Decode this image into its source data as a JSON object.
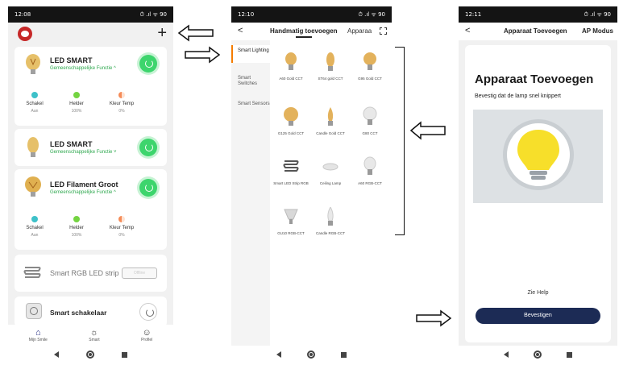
{
  "phone1": {
    "status_time": "12:08",
    "status_right": "⏱ .ıl ᯤ 90",
    "add_label": "+",
    "cards": [
      {
        "title": "LED SMART",
        "subtitle": "Gemeenschappelijke Functie ^",
        "controls": [
          {
            "label": "Schakel",
            "value": "Aan",
            "color": "#3ec1c9"
          },
          {
            "label": "Helder",
            "value": "100%",
            "color": "#74d441"
          },
          {
            "label": "Kleur Temp",
            "value": "0%",
            "color": "#f58b57"
          }
        ]
      },
      {
        "title": "LED SMART",
        "subtitle": "Gemeenschappelijke Functie ˅"
      },
      {
        "title": "LED Filament Groot",
        "subtitle": "Gemeenschappelijke Functie ^",
        "controls": [
          {
            "label": "Schakel",
            "value": "Aan",
            "color": "#3ec1c9"
          },
          {
            "label": "Helder",
            "value": "100%",
            "color": "#74d441"
          },
          {
            "label": "Kleur Temp",
            "value": "0%",
            "color": "#f58b57"
          }
        ]
      },
      {
        "title": "Smart RGB LED strip",
        "pill_label": "Offline"
      },
      {
        "title": "Smart schakelaar"
      }
    ],
    "tabs": [
      {
        "label": "Mijn Smile",
        "icon": "home-icon"
      },
      {
        "label": "Smart",
        "icon": "sun-icon"
      },
      {
        "label": "Profiel",
        "icon": "profile-icon"
      }
    ]
  },
  "phone2": {
    "status_time": "12:10",
    "status_right": "⏱ .ıl ᯤ 90",
    "back_label": "<",
    "tab_manual": "Handmatig toevoegen",
    "tab_ap": "Apparaa",
    "side_items": [
      "Smart Lighting",
      "Smart Switches",
      "Smart Sensors"
    ],
    "products": [
      "A60 Gold CCT",
      "ST64 gold CCT",
      "G95 Gold CCT",
      "G125 Gold CCT",
      "Candle Gold CCT",
      "G80 CCT",
      "Smart LED Strip RGB",
      "Ceiling Lamp",
      "A60 RGB-CCT",
      "GU10 RGB-CCT",
      "Candle RGB-CCT"
    ]
  },
  "phone3": {
    "status_time": "12:11",
    "status_right": "⏱ .ıl ᯤ 90",
    "back_label": "<",
    "title": "Apparaat Toevoegen",
    "mode": "AP Modus",
    "heading": "Apparaat Toevoegen",
    "description": "Bevestig dat de lamp snel knippert",
    "help": "Zie Help",
    "confirm": "Bevestigen"
  },
  "colors": {
    "accent_green": "#3dd56d",
    "confirm_navy": "#1c2b55",
    "bulb_yellow": "#f7df2a"
  }
}
